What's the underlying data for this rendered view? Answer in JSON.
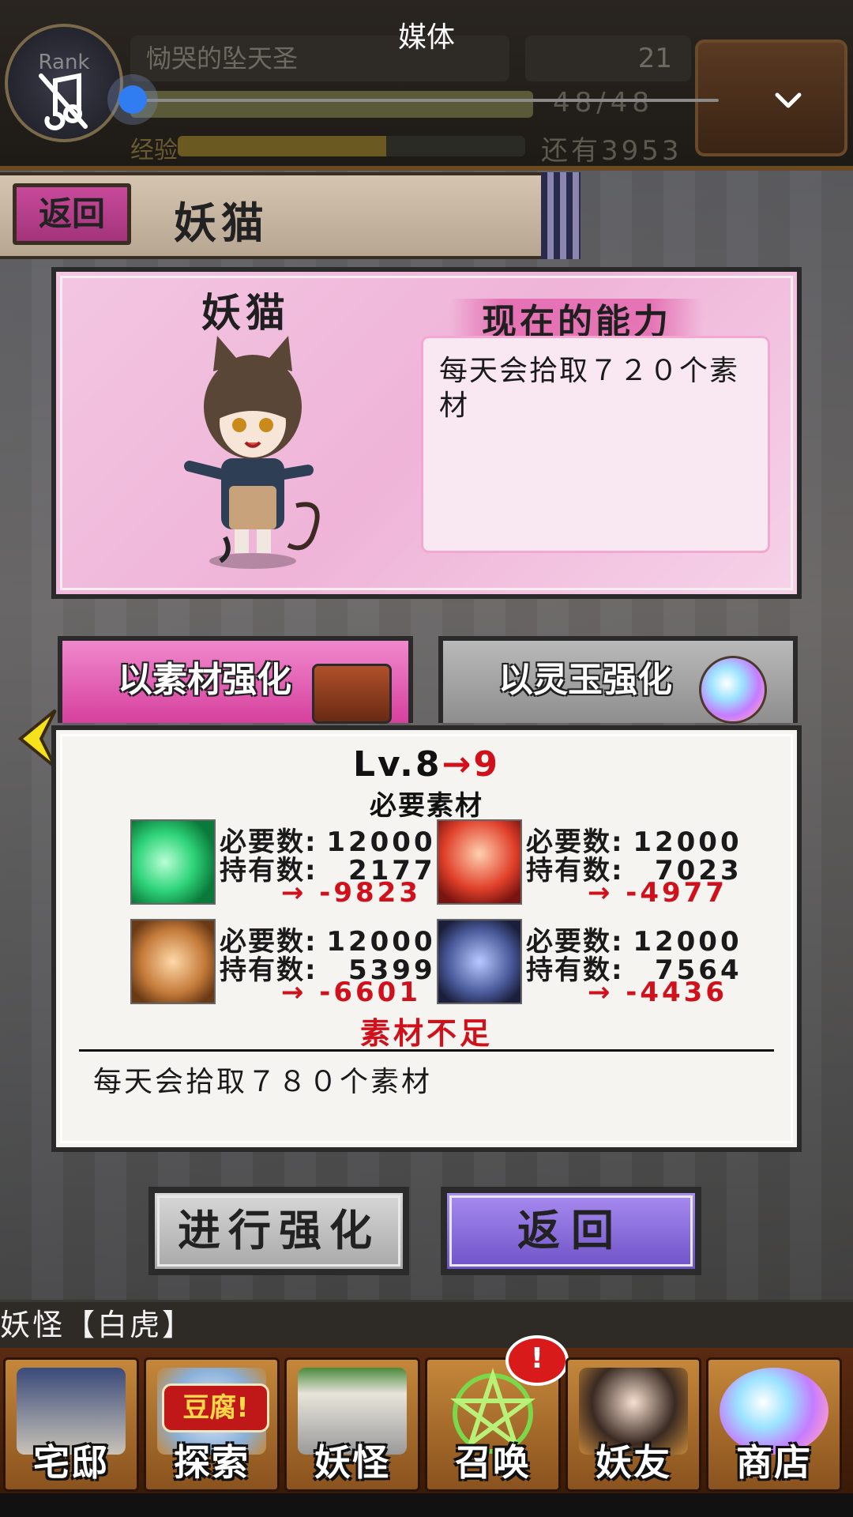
{
  "media_overlay": {
    "title": "媒体"
  },
  "status_bar": {
    "rank_label": "Rank",
    "player_name": "恸哭的坠天圣",
    "coins": "21",
    "stamina_text": "48/48",
    "stamina_fraction": 1.0,
    "exp_label": "经验",
    "exp_fraction": 0.6,
    "exp_remaining": "还有3953"
  },
  "header": {
    "back_label": "返回",
    "title": "妖猫"
  },
  "info_panel": {
    "yokai_name": "妖猫",
    "ability_title": "现在的能力",
    "ability_text": "每天会拾取７２０个素材"
  },
  "tabs": {
    "material": "以素材强化",
    "spirit": "以灵玉强化"
  },
  "enhance": {
    "level_from": "Lv.8",
    "arrow": "→",
    "level_to": "9",
    "required_title": "必要素材",
    "required_label": "必要数:",
    "owned_label": "持有数:",
    "materials": [
      {
        "required": "12000",
        "owned": "2177",
        "diff": "→ -9823"
      },
      {
        "required": "12000",
        "owned": "7023",
        "diff": "→ -4977"
      },
      {
        "required": "12000",
        "owned": "5399",
        "diff": "→ -6601"
      },
      {
        "required": "12000",
        "owned": "7564",
        "diff": "→ -4436"
      }
    ],
    "insufficient": "素材不足",
    "next_ability": "每天会拾取７８０个素材"
  },
  "buttons": {
    "enhance": "进行强化",
    "back": "返回"
  },
  "ticker": {
    "text": "妖怪【白虎】"
  },
  "bottom_nav": {
    "items": [
      {
        "label": "宅邸"
      },
      {
        "label": "探索"
      },
      {
        "label": "妖怪"
      },
      {
        "label": "召唤"
      },
      {
        "label": "妖友"
      },
      {
        "label": "商店"
      }
    ],
    "tofu_tag": "豆腐!",
    "alert_badge": "!"
  },
  "colors": {
    "accent_pink": "#d6409e",
    "warning_red": "#d0101a",
    "media_knob_blue": "#2f7df0",
    "back_button_purple": "#6e52c8"
  }
}
